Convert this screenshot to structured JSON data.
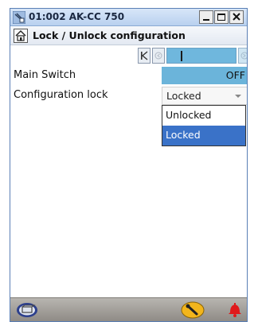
{
  "window": {
    "title": "01:002 AK-CC 750",
    "controls": [
      "minimize",
      "maximize",
      "close"
    ]
  },
  "header": {
    "title": "Lock / Unlock configuration"
  },
  "nav": {
    "buttons": [
      "first-page",
      "previous-page",
      "next-page"
    ],
    "progress_fraction": 0.2
  },
  "rows": [
    {
      "label": "Main Switch",
      "value": "OFF"
    },
    {
      "label": "Configuration lock",
      "value": "Locked"
    }
  ],
  "dropdown": {
    "options": [
      "Unlocked",
      "Locked"
    ],
    "selected_index": 1
  },
  "colors": {
    "highlight_value": "#6bb4da",
    "selected_option": "#3a72c8",
    "footer": "#a09c97",
    "alarm": "#e0191b"
  },
  "footer": {
    "icons": [
      "display-icon",
      "wrench-icon",
      "alarm-bell-icon"
    ]
  }
}
